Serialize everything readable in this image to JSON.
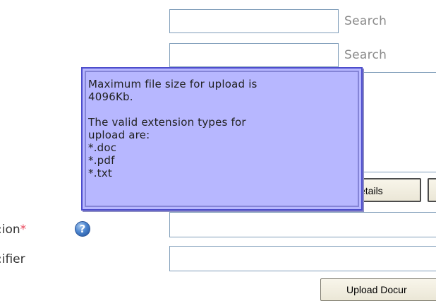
{
  "search_rows": [
    {
      "link": "Search"
    },
    {
      "link": "Search"
    }
  ],
  "buttons": {
    "details": "etails",
    "upload": "Upload Docur"
  },
  "labels": {
    "field1": ":ion",
    "required_marker": "*",
    "field2": ":ifier"
  },
  "help": {
    "icon": "question-help-icon",
    "glyph": "?"
  },
  "tooltip": {
    "line1": "Maximum file size for upload is",
    "line2": "4096Kb.",
    "line3": "The valid extension types for",
    "line4": "upload are:",
    "ext1": "*.doc",
    "ext2": "*.pdf",
    "ext3": "*.txt"
  },
  "colors": {
    "tooltip_bg": "#b7b7ff",
    "tooltip_border": "#4d4dcc",
    "required": "#e8465a",
    "link_gray": "#8a8a8a"
  }
}
